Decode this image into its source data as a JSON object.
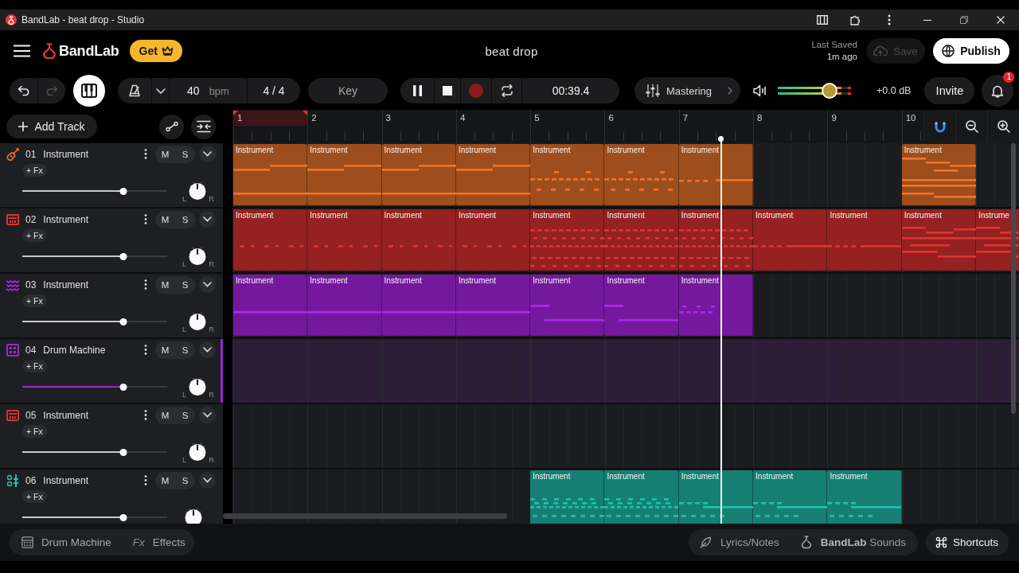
{
  "window": {
    "title": "BandLab - beat drop - Studio"
  },
  "header": {
    "logo": "BandLab",
    "get_button": "Get",
    "project_title": "beat drop",
    "last_saved_label": "Last Saved",
    "last_saved_time": "1m ago",
    "save_button": {
      "label": "Save",
      "disabled": true
    },
    "publish_button": "Publish"
  },
  "toolbar": {
    "undo": {
      "disabled": false
    },
    "redo": {
      "disabled": true
    },
    "tempo": "40",
    "tempo_unit": "bpm",
    "time_signature": "4 / 4",
    "key_button": "Key",
    "playing": true,
    "recording": false,
    "time": "00:39.4",
    "mastering_button": "Mastering",
    "master_volume": {
      "level": 0.68
    },
    "volume_reading": "+0.0 dB",
    "invite_button": "Invite",
    "notification_count": "1"
  },
  "track_panel": {
    "add_track_button": "Add Track"
  },
  "ruler": {
    "bars": [
      {
        "label": "1",
        "selected": true
      },
      {
        "label": "2",
        "selected": false
      },
      {
        "label": "3",
        "selected": false
      },
      {
        "label": "4",
        "selected": false
      },
      {
        "label": "5",
        "selected": false
      },
      {
        "label": "6",
        "selected": false
      },
      {
        "label": "7",
        "selected": false
      },
      {
        "label": "8",
        "selected": false
      },
      {
        "label": "9",
        "selected": false
      },
      {
        "label": "10",
        "selected": false
      }
    ]
  },
  "tracks": [
    {
      "number": "01",
      "name": "Instrument",
      "color": "#f0762a",
      "selected": false,
      "fx_button": "+ Fx",
      "mute_button": "M",
      "solo_button": "S",
      "volume": {
        "level": 0.7
      },
      "pan_labels": [
        "L",
        "R"
      ],
      "slots": [
        {
          "clip": true,
          "label": "Instrument"
        },
        {
          "clip": true,
          "label": "Instrument"
        },
        {
          "clip": true,
          "label": "Instrument"
        },
        {
          "clip": true,
          "label": "Instrument"
        },
        {
          "clip": true,
          "label": "Instrument"
        },
        {
          "clip": true,
          "label": "Instrument"
        },
        {
          "clip": true,
          "label": "Instrument"
        },
        {
          "clip": false
        },
        {
          "clip": false
        },
        {
          "clip": true,
          "label": "Instrument"
        }
      ]
    },
    {
      "number": "02",
      "name": "Instrument",
      "color": "#e23232",
      "selected": false,
      "fx_button": "+ Fx",
      "mute_button": "M",
      "solo_button": "S",
      "volume": {
        "level": 0.7
      },
      "pan_labels": [
        "L",
        "R"
      ],
      "slots": [
        {
          "clip": true,
          "label": "Instrument"
        },
        {
          "clip": true,
          "label": "Instrument"
        },
        {
          "clip": true,
          "label": "Instrument"
        },
        {
          "clip": true,
          "label": "Instrument"
        },
        {
          "clip": true,
          "label": "Instrument"
        },
        {
          "clip": true,
          "label": "Instrument"
        },
        {
          "clip": true,
          "label": "Instrument"
        },
        {
          "clip": true,
          "label": "Instrument"
        },
        {
          "clip": true,
          "label": "Instrument"
        },
        {
          "clip": true,
          "label": "Instrument"
        },
        {
          "clip": true,
          "label": "Instrume"
        }
      ]
    },
    {
      "number": "03",
      "name": "Instrument",
      "color": "#b026f0",
      "selected": false,
      "fx_button": "+ Fx",
      "mute_button": "M",
      "solo_button": "S",
      "volume": {
        "level": 0.7
      },
      "pan_labels": [
        "L",
        "R"
      ],
      "slots": [
        {
          "clip": true,
          "label": "Instrument"
        },
        {
          "clip": true,
          "label": "Instrument"
        },
        {
          "clip": true,
          "label": "Instrument"
        },
        {
          "clip": true,
          "label": "Instrument"
        },
        {
          "clip": true,
          "label": "Instrument"
        },
        {
          "clip": true,
          "label": "Instrument"
        },
        {
          "clip": true,
          "label": "Instrument"
        }
      ]
    },
    {
      "number": "04",
      "name": "Drum Machine",
      "color": "#9b27d6",
      "selected": true,
      "fx_button": "+ Fx",
      "mute_button": "M",
      "solo_button": "S",
      "volume": {
        "level": 0.7
      },
      "pan_labels": [
        "L",
        "R"
      ]
    },
    {
      "number": "05",
      "name": "Instrument",
      "color": "#d83030",
      "selected": false,
      "fx_button": "+ Fx",
      "mute_button": "M",
      "solo_button": "S",
      "volume": {
        "level": 0.7
      },
      "pan_labels": [
        "L",
        "R"
      ]
    },
    {
      "number": "06",
      "name": "Instrument",
      "color": "#22c0b0",
      "selected": false,
      "fx_button": "+ Fx",
      "mute_button": "M",
      "solo_button": "S",
      "volume": {
        "level": 0.7
      },
      "slots": [
        {
          "clip": false
        },
        {
          "clip": false
        },
        {
          "clip": false
        },
        {
          "clip": false
        },
        {
          "clip": true,
          "label": "Instrument"
        },
        {
          "clip": true,
          "label": "Instrument"
        },
        {
          "clip": true,
          "label": "Instrument"
        },
        {
          "clip": true,
          "label": "Instrument"
        },
        {
          "clip": true,
          "label": "Instrument"
        }
      ]
    }
  ],
  "bottom_bar": {
    "left_tabs": [
      {
        "label": "Drum Machine"
      },
      {
        "glyph": "Fx",
        "label": "Effects"
      }
    ],
    "right_tabs": [
      {
        "label": "Lyrics/Notes"
      },
      {
        "label": "**BandLab** Sounds"
      }
    ],
    "shortcuts_button": "Shortcuts"
  }
}
